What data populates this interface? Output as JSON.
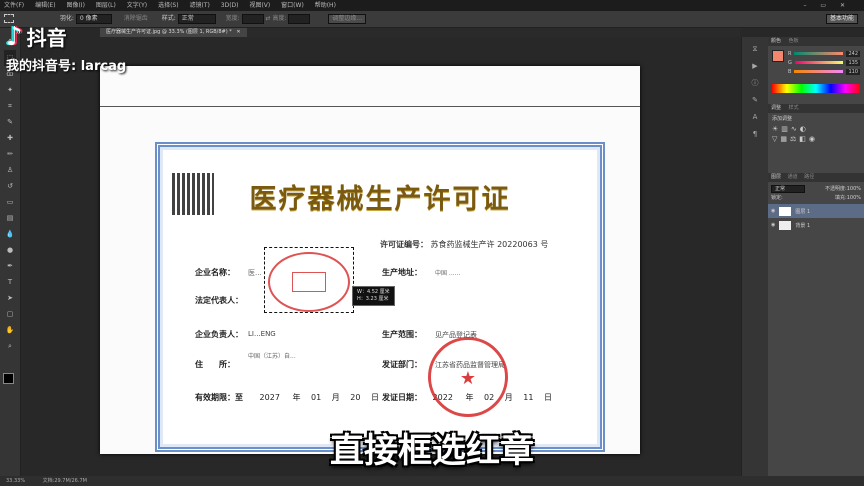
{
  "menubar": {
    "items": [
      "文件(F)",
      "编辑(E)",
      "图像(I)",
      "图层(L)",
      "文字(Y)",
      "选择(S)",
      "滤镜(T)",
      "3D(D)",
      "视图(V)",
      "窗口(W)",
      "帮助(H)"
    ]
  },
  "options": {
    "feather_label": "羽化:",
    "feather_value": "0 像素",
    "antialias": "消除锯齿",
    "style_label": "样式:",
    "style_value": "正常",
    "width_label": "宽度:",
    "height_label": "高度:",
    "refine_button": "调整边缘...",
    "workspace": "基本功能"
  },
  "document_tab": {
    "title": "医疗器械生产许可证.jpg @ 33.3% (图层 1, RGB/8#) *"
  },
  "certificate": {
    "title": "医疗器械生产许可证",
    "license_label": "许可证编号：",
    "license_value": "苏食药监械生产许 20220063 号",
    "company_label": "企业名称：",
    "company_value": "医...",
    "address_label": "生产地址：",
    "address_value": "中国 ......",
    "legal_label": "法定代表人：",
    "responsible_label": "企业负责人：",
    "responsible_value": "LI...ENG",
    "scope_label": "生产范围：",
    "scope_value": "见产品登记表",
    "residence_label": "住　　所：",
    "residence_value": "中国（江苏）自...",
    "issuer_label": "发证部门：",
    "issuer_value": "江苏省药品监督管理局",
    "validity_label": "有效期限：至",
    "validity_year": "2027",
    "validity_month": "01",
    "validity_day": "20",
    "issue_label": "发证日期：",
    "issue_year": "2022",
    "issue_month": "02",
    "issue_day": "11",
    "unit_year": "年",
    "unit_month": "月",
    "unit_day": "日"
  },
  "selection_info": {
    "w": "W：4.52 厘米",
    "h": "H：3.23 厘米"
  },
  "color_panel": {
    "tab1": "颜色",
    "tab2": "色板",
    "r_label": "R",
    "r_value": "242",
    "g_label": "G",
    "g_value": "135",
    "b_label": "B",
    "b_value": "110"
  },
  "adjust_panel": {
    "tab1": "调整",
    "tab2": "样式",
    "title": "添加调整"
  },
  "layers_panel": {
    "tab1": "图层",
    "tab2": "通道",
    "tab3": "路径",
    "blend_mode": "正常",
    "opacity_label": "不透明度:",
    "opacity_value": "100%",
    "fill_label": "填充:",
    "fill_value": "100%",
    "lock_label": "锁定:",
    "layers": [
      "图层 1",
      "背景 1"
    ]
  },
  "status": {
    "zoom": "33.33%",
    "doc": "文档:29.7M/26.7M"
  },
  "watermark": {
    "app_name": "抖音",
    "account": "我的抖音号: larcag"
  },
  "caption": "直接框选红章",
  "colors": {
    "seal_red": "#d62828",
    "gold_title": "#7a5a10",
    "border_blue": "#6b8fc9",
    "swatch": "#f2876e"
  }
}
